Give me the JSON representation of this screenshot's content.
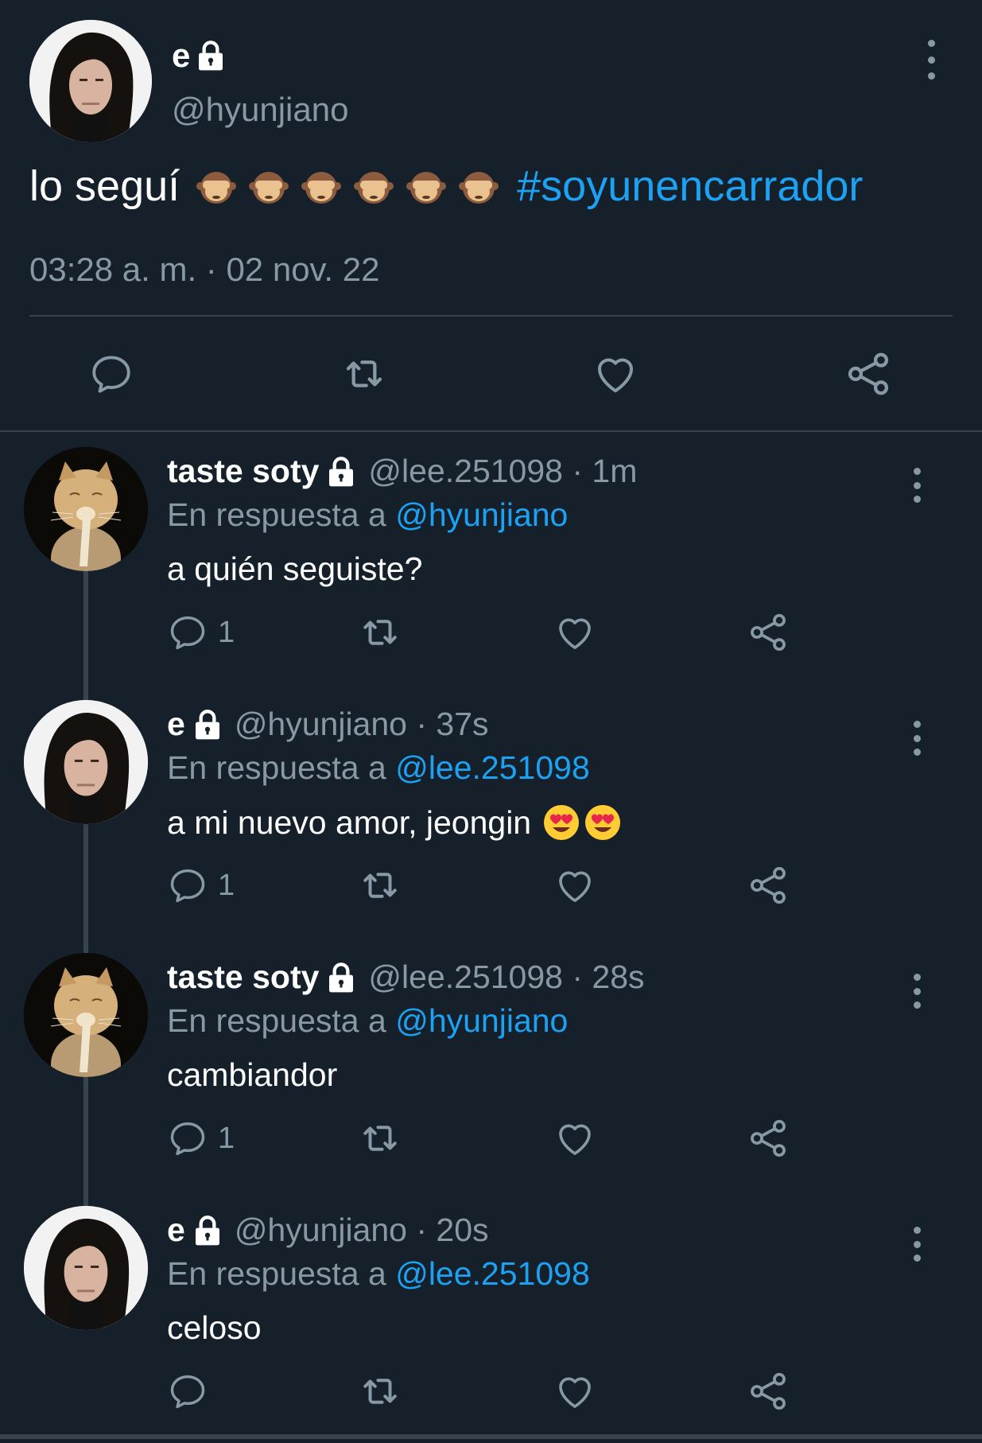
{
  "colors": {
    "background": "#15202b",
    "accent": "#1da1f2",
    "muted": "#8899a6",
    "divider": "#38444d",
    "text": "#ffffff"
  },
  "main_tweet": {
    "name": "e",
    "handle": "@hyunjiano",
    "text": "lo seguí",
    "emoji": "see-no-evil-monkey",
    "emoji_count": 6,
    "hashtag": "#soyunencarrador",
    "timestamp": "03:28 a. m. · 02 nov. 22",
    "actions": [
      "reply-icon",
      "retweet-icon",
      "like-icon",
      "share-icon"
    ]
  },
  "replies": [
    {
      "name": "taste soty",
      "avatar": "cat-avatar",
      "meta": "@lee.251098 · 1m",
      "reply_prefix": "En respuesta a",
      "reply_to": "@hyunjiano",
      "text": "a quién seguiste?",
      "reply_count": "1"
    },
    {
      "name": "e",
      "avatar": "man-avatar",
      "meta": "@hyunjiano · 37s",
      "reply_prefix": "En respuesta a",
      "reply_to": "@lee.251098",
      "text": "a mi nuevo amor, jeongin",
      "emojis": [
        "heart-eyes-emoji",
        "heart-eyes-emoji"
      ],
      "reply_count": "1"
    },
    {
      "name": "taste soty",
      "avatar": "cat-avatar",
      "meta": "@lee.251098 · 28s",
      "reply_prefix": "En respuesta a",
      "reply_to": "@hyunjiano",
      "text": "cambiandor",
      "reply_count": "1"
    },
    {
      "name": "e",
      "avatar": "man-avatar",
      "meta": "@hyunjiano · 20s",
      "reply_prefix": "En respuesta a",
      "reply_to": "@lee.251098",
      "text": "celoso",
      "reply_count": ""
    }
  ]
}
